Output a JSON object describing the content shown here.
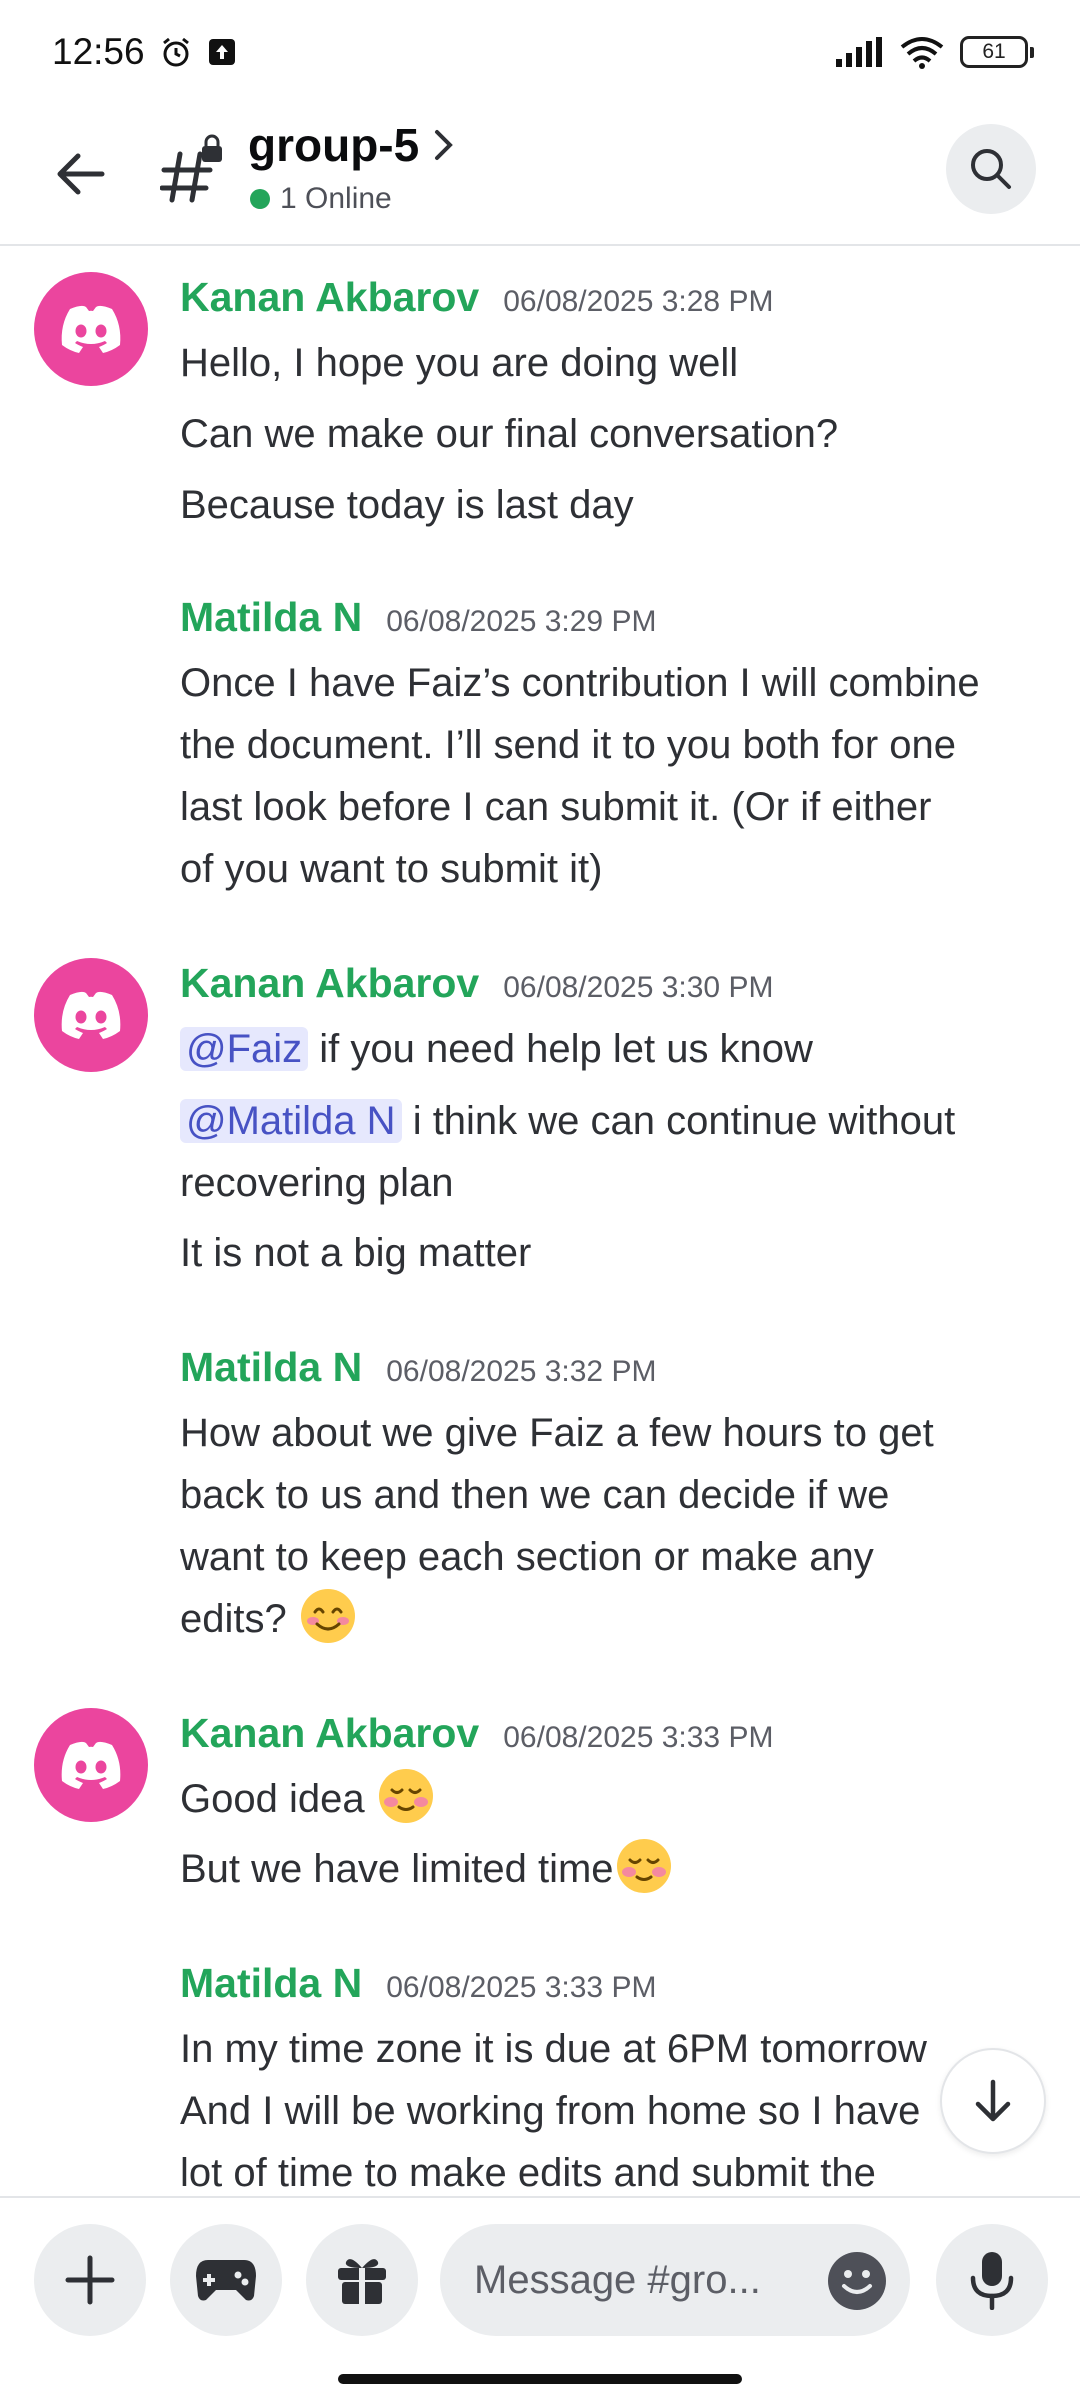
{
  "status_bar": {
    "time": "12:56",
    "battery": "61"
  },
  "header": {
    "channel_name": "group-5",
    "online": "1 Online"
  },
  "messages": [
    {
      "author": "Kanan Akbarov",
      "timestamp": "06/08/2025 3:28 PM",
      "lines": [
        "Hello, I hope you are doing well",
        "Can we make our final conversation?",
        "Because today is last day"
      ]
    },
    {
      "author": "Matilda N",
      "timestamp": "06/08/2025 3:29 PM",
      "lines": [
        "Once I have Faiz’s contribution I will combine",
        "the document. I’ll send it to you both for one",
        "last look before I can submit it. (Or if either",
        "of you want to submit it)"
      ]
    },
    {
      "author": "Kanan Akbarov",
      "timestamp": "06/08/2025 3:30 PM",
      "mention_1": "@Faiz",
      "line_1_rest": " if you need help let us know",
      "mention_2": "@Matilda N",
      "line_2_rest": "i think we can continue without",
      "lines": [
        "recovering plan",
        "It is not a big matter"
      ]
    },
    {
      "author": "Matilda N",
      "timestamp": "06/08/2025 3:32 PM",
      "lines": [
        "How about we give Faiz a few hours to get",
        "back to us and then we can decide if we",
        "want to keep each section or make any",
        "edits?"
      ]
    },
    {
      "author": "Kanan Akbarov",
      "timestamp": "06/08/2025 3:33 PM",
      "lines": [
        "Good idea",
        "But we have limited time"
      ]
    },
    {
      "author": "Matilda N",
      "timestamp": "06/08/2025 3:33 PM",
      "lines": [
        "In my time zone it is due at 6PM tomorrow",
        "And I will be working from home so I have",
        "lot of time to make edits and submit the"
      ]
    }
  ],
  "composer": {
    "placeholder": "Message #gro..."
  },
  "colors": {
    "author": "#23a55a",
    "avatar": "#eb459e",
    "mention_bg": "#e6e8fd",
    "mention_text": "#4752c4"
  },
  "icons": {
    "back": "arrow-left-icon",
    "channel": "locked-hash-icon",
    "search": "search-icon",
    "add": "plus-icon",
    "games": "gamepad-icon",
    "gift": "gift-icon",
    "emoji": "emoji-icon",
    "mic": "microphone-icon",
    "scroll": "arrow-down-icon"
  }
}
